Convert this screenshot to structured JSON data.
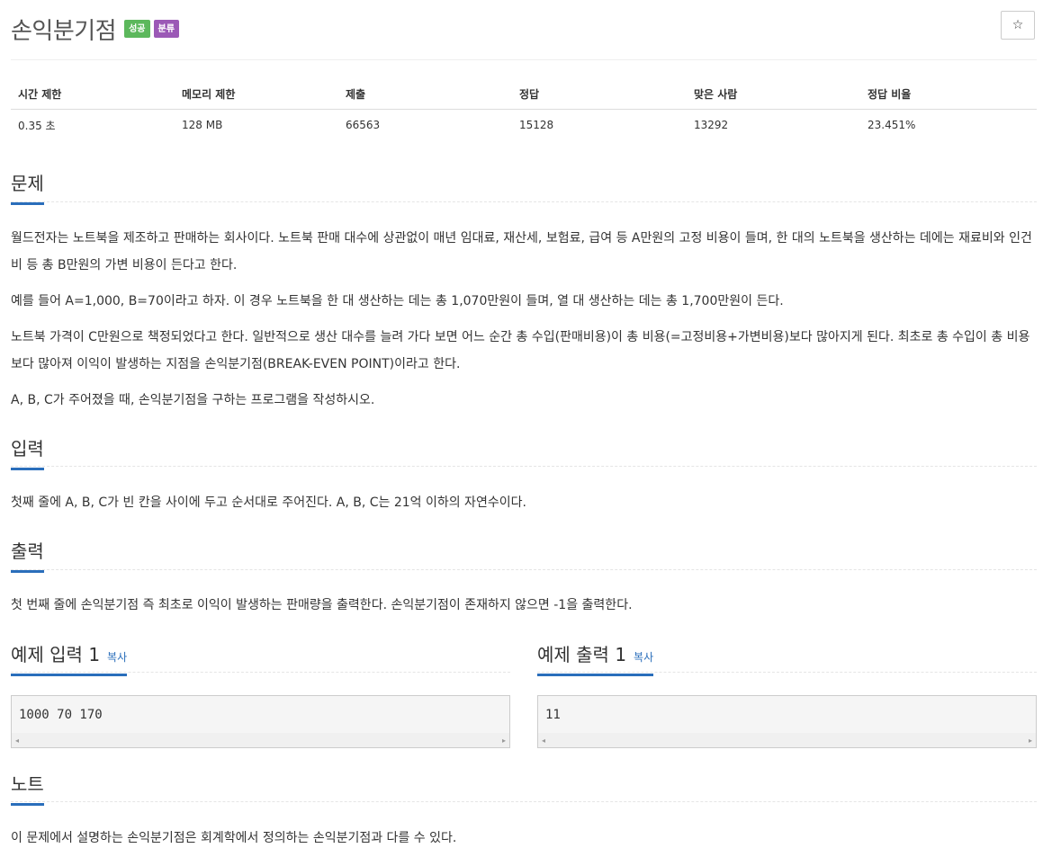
{
  "problem": {
    "title": "손익분기점",
    "badges": {
      "success": "성공",
      "category": "분류"
    },
    "star_icon": "☆"
  },
  "info_table": {
    "headers": [
      "시간 제한",
      "메모리 제한",
      "제출",
      "정답",
      "맞은 사람",
      "정답 비율"
    ],
    "values": [
      "0.35 초",
      "128 MB",
      "66563",
      "15128",
      "13292",
      "23.451%"
    ]
  },
  "sections": {
    "description": {
      "title": "문제",
      "paragraphs": [
        "월드전자는 노트북을 제조하고 판매하는 회사이다. 노트북 판매 대수에 상관없이 매년 임대료, 재산세, 보험료, 급여 등 A만원의 고정 비용이 들며, 한 대의 노트북을 생산하는 데에는 재료비와 인건비 등 총 B만원의 가변 비용이 든다고 한다.",
        "예를 들어 A=1,000, B=70이라고 하자. 이 경우 노트북을 한 대 생산하는 데는 총 1,070만원이 들며, 열 대 생산하는 데는 총 1,700만원이 든다.",
        "노트북 가격이 C만원으로 책정되었다고 한다. 일반적으로 생산 대수를 늘려 가다 보면 어느 순간 총 수입(판매비용)이 총 비용(=고정비용+가변비용)보다 많아지게 된다. 최초로 총 수입이 총 비용보다 많아져 이익이 발생하는 지점을 손익분기점(BREAK-EVEN POINT)이라고 한다.",
        "A, B, C가 주어졌을 때, 손익분기점을 구하는 프로그램을 작성하시오."
      ]
    },
    "input": {
      "title": "입력",
      "text": "첫째 줄에 A, B, C가 빈 칸을 사이에 두고 순서대로 주어진다. A, B, C는 21억 이하의 자연수이다."
    },
    "output": {
      "title": "출력",
      "text": "첫 번째 줄에 손익분기점 즉 최초로 이익이 발생하는 판매량을 출력한다. 손익분기점이 존재하지 않으면 -1을 출력한다."
    },
    "sample_input": {
      "title": "예제 입력 1",
      "copy": "복사",
      "code": "1000 70 170"
    },
    "sample_output": {
      "title": "예제 출력 1",
      "copy": "복사",
      "code": "11"
    },
    "note": {
      "title": "노트",
      "text": "이 문제에서 설명하는 손익분기점은 회계학에서 정의하는 손익분기점과 다를 수 있다."
    }
  },
  "scroll_arrows": {
    "left": "◂",
    "right": "▸"
  }
}
